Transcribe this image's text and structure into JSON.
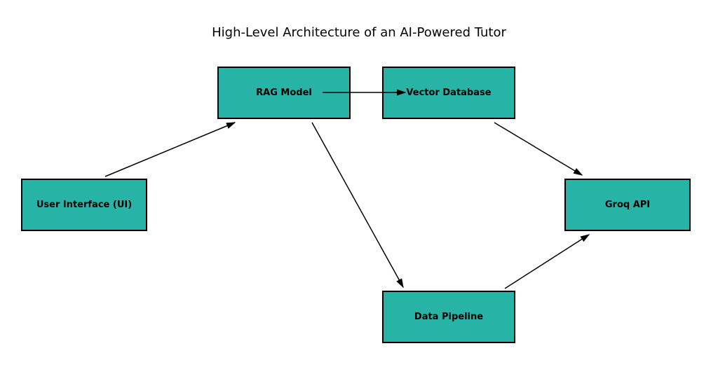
{
  "title": "High-Level Architecture of an AI-Powered Tutor",
  "nodes": {
    "ui": {
      "label": "User Interface (UI)"
    },
    "rag": {
      "label": "RAG Model"
    },
    "vector": {
      "label": "Vector Database"
    },
    "groq": {
      "label": "Groq API"
    },
    "pipeline": {
      "label": "Data Pipeline"
    }
  },
  "colors": {
    "node_fill": "#28b3a7",
    "node_border": "#000000",
    "arrow": "#000000"
  },
  "edges": [
    {
      "from": "ui",
      "to": "rag"
    },
    {
      "from": "rag",
      "to": "vector"
    },
    {
      "from": "rag",
      "to": "pipeline"
    },
    {
      "from": "vector",
      "to": "groq"
    },
    {
      "from": "pipeline",
      "to": "groq"
    }
  ]
}
